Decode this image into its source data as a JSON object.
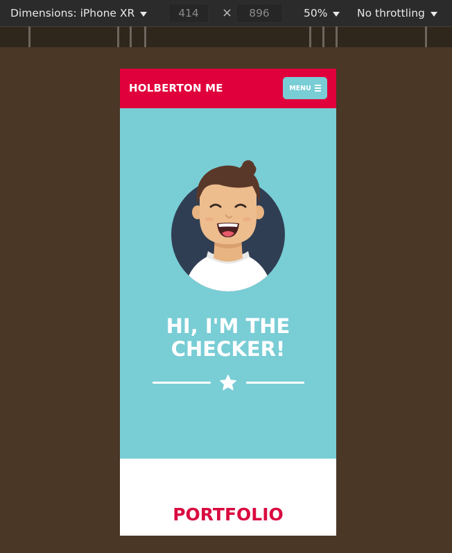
{
  "devtools": {
    "dimensions_label": "Dimensions: iPhone XR",
    "width_value": "414",
    "height_value": "896",
    "times_symbol": "×",
    "zoom_label": "50%",
    "throttling_label": "No throttling"
  },
  "site": {
    "brand": "HOLBERTON ME",
    "menu_label": "MENU",
    "hero_title_line1": "HI, I'M THE",
    "hero_title_line2": "CHECKER!",
    "portfolio_title": "PORTFOLIO"
  },
  "colors": {
    "header_red": "#e0003b",
    "hero_teal": "#79cdd5",
    "portfolio_red": "#d90a40",
    "page_backdrop": "#4a3726"
  },
  "icons": {
    "caret": "caret-down-icon",
    "hamburger": "hamburger-icon",
    "star": "star-icon"
  }
}
